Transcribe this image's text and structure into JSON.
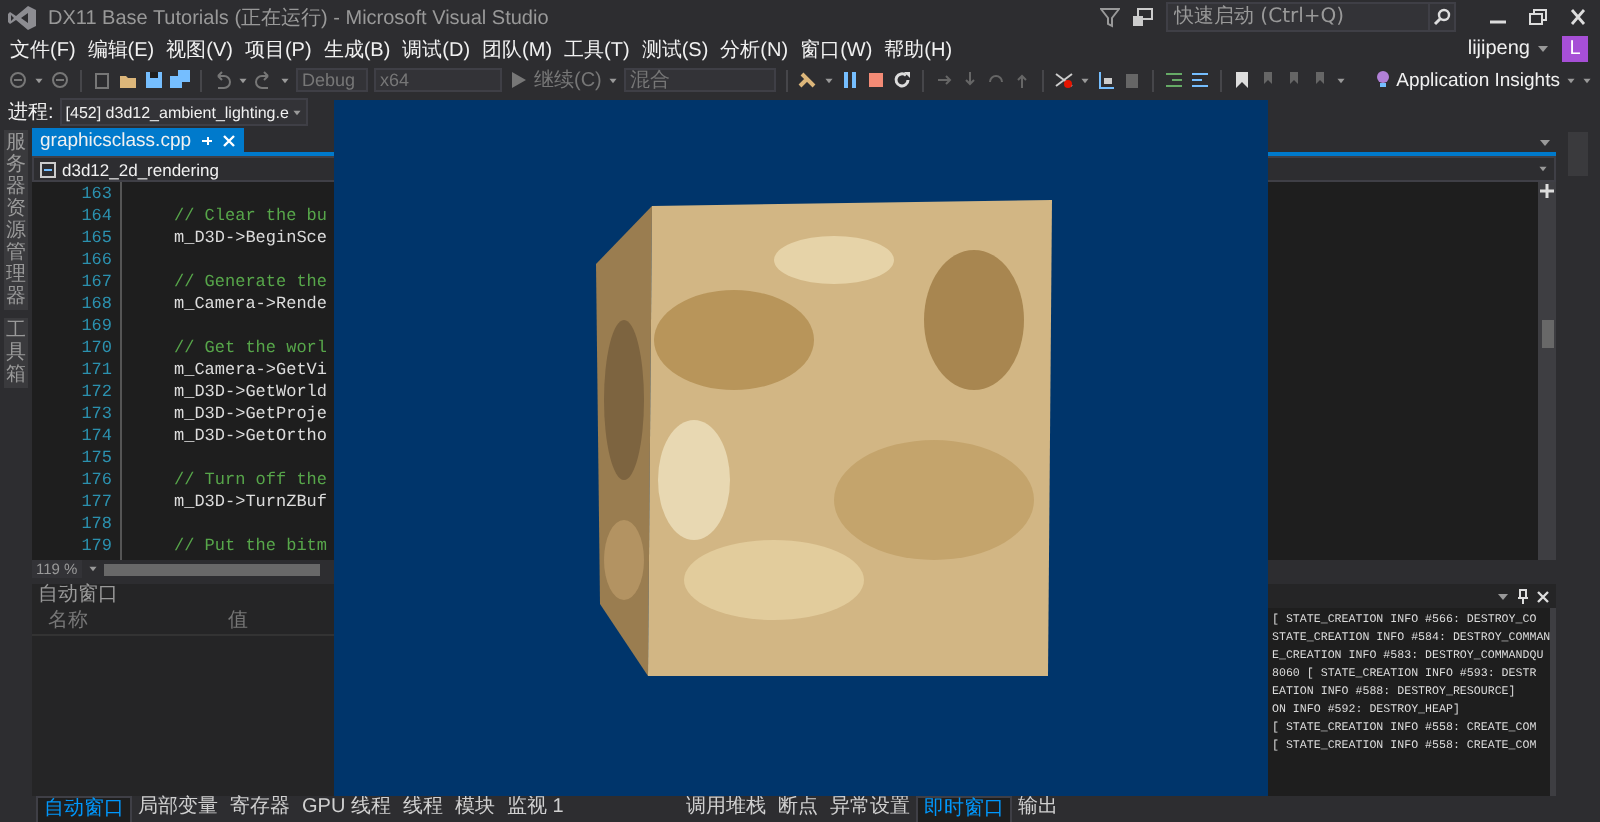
{
  "window": {
    "title": "DX11 Base Tutorials (正在运行) - Microsoft Visual Studio"
  },
  "quick_launch": {
    "placeholder": "快速启动 (Ctrl+Q)"
  },
  "menu": [
    "文件(F)",
    "编辑(E)",
    "视图(V)",
    "项目(P)",
    "生成(B)",
    "调试(D)",
    "团队(M)",
    "工具(T)",
    "测试(S)",
    "分析(N)",
    "窗口(W)",
    "帮助(H)"
  ],
  "user": {
    "name": "lijipeng",
    "initial": "L"
  },
  "toolbar": {
    "configuration": "Debug",
    "platform": "x64",
    "continue": "继续(C)",
    "debugger": "混合",
    "insights": "Application Insights"
  },
  "process": {
    "label": "进程:",
    "value": "[452] d3d12_ambient_lighting.e"
  },
  "side_tabs": [
    "服务器资源管理器",
    "工具箱"
  ],
  "editor": {
    "tabs": [
      {
        "label": "graphicsclass.cpp",
        "selected": true
      }
    ],
    "scope": "d3d12_2d_rendering",
    "zoom": "119 %",
    "lines": [
      {
        "number": "163",
        "kind": "blank"
      },
      {
        "number": "164",
        "kind": "comment",
        "text": "// Clear the bu"
      },
      {
        "number": "165",
        "kind": "code",
        "text": "m_D3D->BeginSce"
      },
      {
        "number": "166",
        "kind": "blank"
      },
      {
        "number": "167",
        "kind": "comment",
        "text": "// Generate the"
      },
      {
        "number": "168",
        "kind": "code",
        "text": "m_Camera->Rende"
      },
      {
        "number": "169",
        "kind": "blank"
      },
      {
        "number": "170",
        "kind": "comment",
        "text": "// Get the worl"
      },
      {
        "number": "171",
        "kind": "code",
        "text": "m_Camera->GetVi"
      },
      {
        "number": "172",
        "kind": "code",
        "text": "m_D3D->GetWorld"
      },
      {
        "number": "173",
        "kind": "code",
        "text": "m_D3D->GetProje"
      },
      {
        "number": "174",
        "kind": "code",
        "text": "m_D3D->GetOrtho"
      },
      {
        "number": "175",
        "kind": "blank"
      },
      {
        "number": "176",
        "kind": "comment",
        "text": "// Turn off the"
      },
      {
        "number": "177",
        "kind": "code",
        "text": "m_D3D->TurnZBuf"
      },
      {
        "number": "178",
        "kind": "blank"
      },
      {
        "number": "179",
        "kind": "comment",
        "text": "// Put the bitm"
      }
    ]
  },
  "autos": {
    "title": "自动窗口",
    "columns": [
      "名称",
      "值"
    ]
  },
  "output": {
    "lines": [
      "[ STATE_CREATION INFO #566: DESTROY_CO",
      "STATE_CREATION INFO #584: DESTROY_COMMAN",
      "E_CREATION INFO #583: DESTROY_COMMANDQU",
      "8060 [ STATE_CREATION INFO #593: DESTR",
      "EATION INFO #588: DESTROY_RESOURCE]",
      "ON INFO #592: DESTROY_HEAP]",
      "[ STATE_CREATION INFO #558: CREATE_COM",
      "[ STATE_CREATION INFO #558: CREATE_COM"
    ]
  },
  "bottom_tabs_left": [
    {
      "label": "自动窗口",
      "selected": true
    },
    {
      "label": "局部变量",
      "selected": false
    },
    {
      "label": "寄存器",
      "selected": false
    },
    {
      "label": "GPU 线程",
      "selected": false
    },
    {
      "label": "线程",
      "selected": false
    },
    {
      "label": "模块",
      "selected": false
    },
    {
      "label": "监视 1",
      "selected": false
    }
  ],
  "bottom_tabs_right": [
    {
      "label": "调用堆栈",
      "selected": false
    },
    {
      "label": "断点",
      "selected": false
    },
    {
      "label": "异常设置",
      "selected": false
    },
    {
      "label": "即时窗口",
      "selected": true
    },
    {
      "label": "输出",
      "selected": false
    }
  ]
}
